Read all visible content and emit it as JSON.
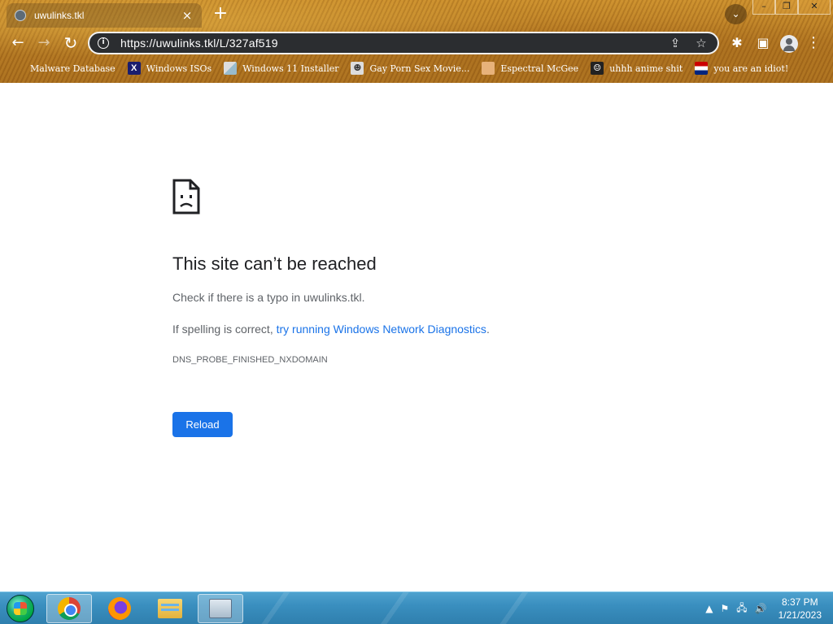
{
  "window": {
    "tab_title": "uwulinks.tkl",
    "tab_close_glyph": "×",
    "new_tab_glyph": "+",
    "tab_search_glyph": "⌄",
    "minimize_glyph": "–",
    "restore_glyph": "❐",
    "close_glyph": "✕"
  },
  "toolbar": {
    "back_glyph": "←",
    "forward_glyph": "→",
    "reload_glyph": "↻",
    "url": "https://uwulinks.tkl/L/327af519",
    "info_glyph": "i",
    "share_glyph": "⇪",
    "star_glyph": "☆",
    "extensions_glyph": "✱",
    "sidepanel_glyph": "▣",
    "menu_glyph": "⋮"
  },
  "bookmarks": [
    {
      "label": "Malware Database",
      "icon": "malware-icon",
      "glyph": ""
    },
    {
      "label": "Windows ISOs",
      "icon": "x-icon",
      "glyph": "X"
    },
    {
      "label": "Windows 11 Installer",
      "icon": "window-icon",
      "glyph": ""
    },
    {
      "label": "Gay Porn Sex Movie...",
      "icon": "gp-icon",
      "glyph": "☻"
    },
    {
      "label": "Espectral McGee",
      "icon": "face-icon",
      "glyph": ""
    },
    {
      "label": "uhhh anime shit",
      "icon": "anime-icon",
      "glyph": "☺"
    },
    {
      "label": "you are an idiot!",
      "icon": "flag-icon",
      "glyph": ""
    }
  ],
  "error_page": {
    "title": "This site can’t be reached",
    "line1": "Check if there is a typo in uwulinks.tkl.",
    "line2_prefix": "If spelling is correct, ",
    "line2_link": "try running Windows Network Diagnostics",
    "line2_suffix": ".",
    "error_code": "DNS_PROBE_FINISHED_NXDOMAIN",
    "reload_label": "Reload"
  },
  "taskbar": {
    "apps": [
      "chrome-icon",
      "firefox-icon",
      "file-explorer-icon",
      "system-monitor-icon"
    ],
    "tray_arrow": "▲",
    "tray_flag": "⚑",
    "tray_network": "🖧",
    "tray_volume": "🔊",
    "time": "8:37 PM",
    "date": "1/21/2023"
  },
  "colors": {
    "accent": "#1a73e8",
    "taskbar": "#3a8fbf",
    "chrome_theme": "#b07421"
  }
}
